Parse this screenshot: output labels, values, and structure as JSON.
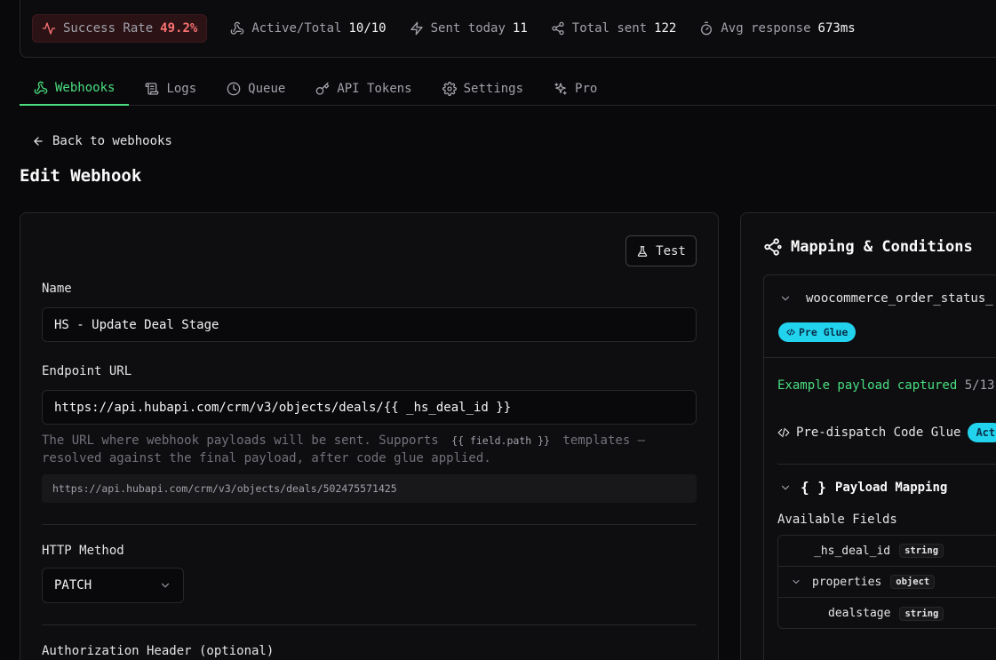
{
  "stats": {
    "success_label": "Success Rate",
    "success_value": "49.2%",
    "active_label": "Active/Total",
    "active_value": "10/10",
    "sent_today_label": "Sent today",
    "sent_today_value": "11",
    "total_sent_label": "Total sent",
    "total_sent_value": "122",
    "avg_label": "Avg response",
    "avg_value": "673ms"
  },
  "tabs": [
    {
      "label": "Webhooks",
      "icon": "webhook-icon",
      "active": true
    },
    {
      "label": "Logs",
      "icon": "scroll-icon"
    },
    {
      "label": "Queue",
      "icon": "clock-icon"
    },
    {
      "label": "API Tokens",
      "icon": "key-icon"
    },
    {
      "label": "Settings",
      "icon": "gear-icon"
    },
    {
      "label": "Pro",
      "icon": "sparkles-icon"
    }
  ],
  "back_label": "Back to webhooks",
  "page_title": "Edit Webhook",
  "form": {
    "test_label": "Test",
    "name_label": "Name",
    "name_value": "HS - Update Deal Stage",
    "url_label": "Endpoint URL",
    "url_value": "https://api.hubapi.com/crm/v3/objects/deals/{{ _hs_deal_id }}",
    "help_before": "The URL where webhook payloads will be sent. Supports",
    "help_chip": "{{ field.path }}",
    "help_after": "templates — resolved against the final payload, after code glue applied.",
    "url_preview": "https://api.hubapi.com/crm/v3/objects/deals/502475571425",
    "method_label": "HTTP Method",
    "method_value": "PATCH",
    "auth_label": "Authorization Header (optional)"
  },
  "mapping": {
    "title": "Mapping & Conditions",
    "hook_name": "woocommerce_order_status_",
    "pre_glue_badge": "Pre Glue",
    "captured_text": "Example payload captured",
    "captured_date": "5/13",
    "glue_label": "Pre-dispatch Code Glue",
    "glue_badge": "Act",
    "payload_mapping_label": "Payload Mapping",
    "available_fields_label": "Available Fields",
    "fields": [
      {
        "name": "_hs_deal_id",
        "type": "string"
      },
      {
        "name": "properties",
        "type": "object"
      },
      {
        "name": "dealstage",
        "type": "string"
      }
    ]
  },
  "colors": {
    "accent_green": "#4ade80",
    "error_red": "#f87171",
    "badge_cyan": "#22d3ee"
  }
}
